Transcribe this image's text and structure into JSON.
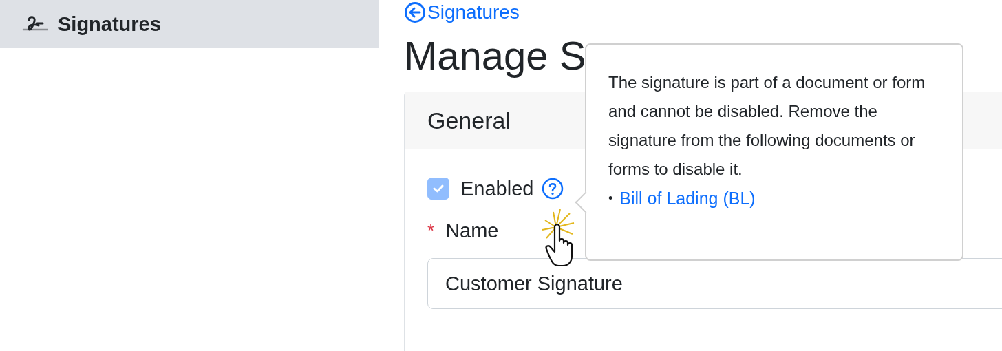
{
  "sidebar": {
    "items": [
      {
        "label": "Signatures",
        "selected": true
      }
    ]
  },
  "back_link": {
    "label": "Signatures"
  },
  "page_title": "Manage S",
  "card": {
    "title": "General",
    "enabled": {
      "label": "Enabled",
      "checked": true,
      "disabled": true
    },
    "name_field": {
      "label": "Name",
      "required_mark": "*",
      "value": "Customer Signature"
    }
  },
  "popover": {
    "text": "The signature is part of a document or form and cannot be disabled. Remove the signature from the following documents or forms to disable it.",
    "items": [
      {
        "bullet": "•",
        "label": "Bill of Lading (BL)"
      }
    ]
  }
}
